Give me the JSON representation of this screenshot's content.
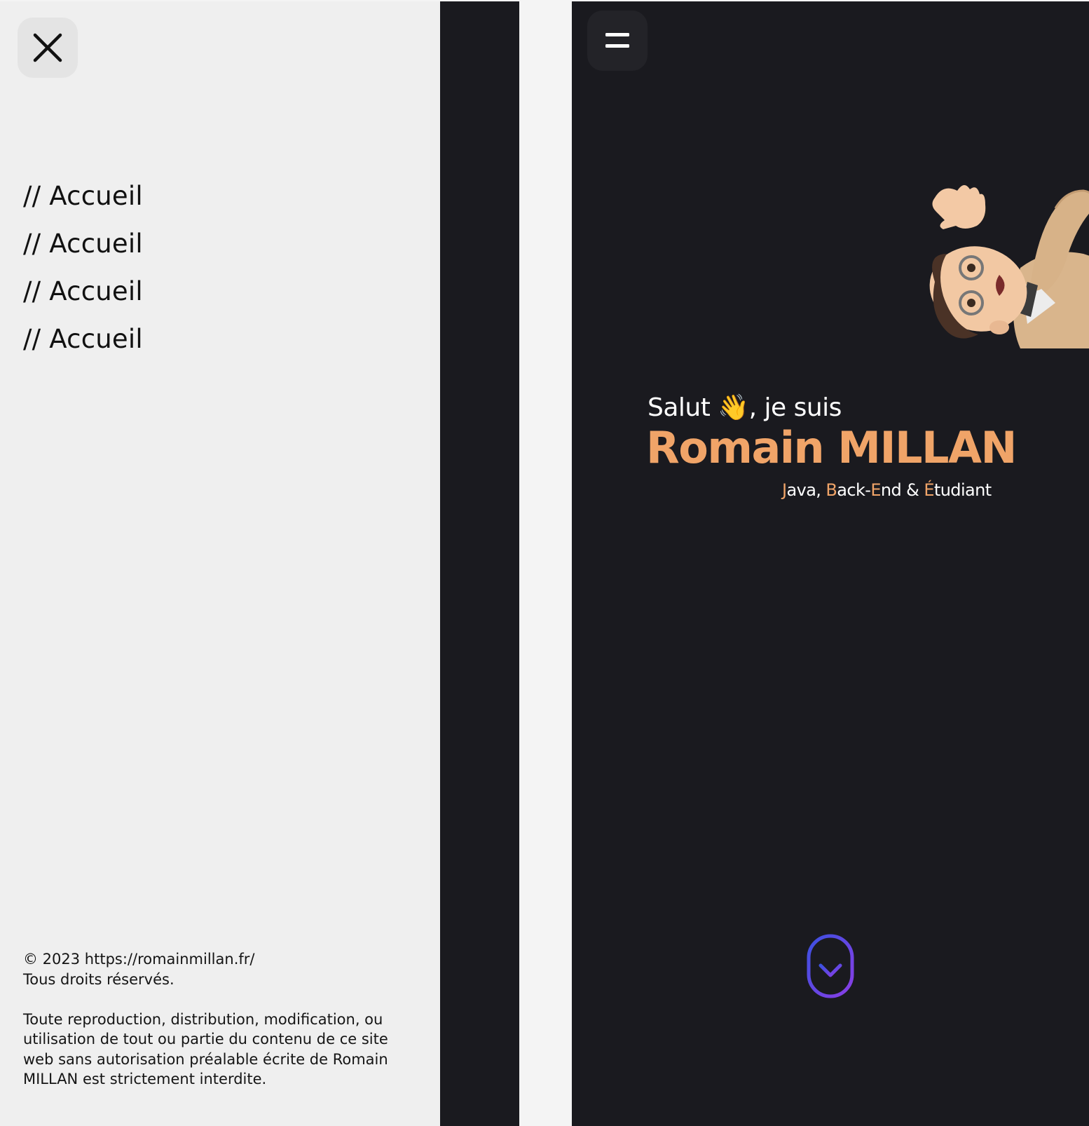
{
  "drawer": {
    "close_icon": "close-icon",
    "nav_items": [
      {
        "label": "// Accueil"
      },
      {
        "label": "// Accueil"
      },
      {
        "label": "// Accueil"
      },
      {
        "label": "// Accueil"
      }
    ],
    "copyright_line1": "© 2023 https://romainmillan.fr/",
    "copyright_line2": "Tous droits réservés.",
    "legal_notice": "Toute reproduction, distribution, modification, ou utilisation de tout ou partie du contenu de ce site web sans autorisation préalable écrite de Romain MILLAN est strictement interdite."
  },
  "hero": {
    "menu_icon": "hamburger-menu-icon",
    "greeting_before": "Salut ",
    "greeting_emoji": "👋",
    "greeting_after": ", je suis",
    "name": "Romain MILLAN",
    "tagline": {
      "j": "J",
      "java_rest": "ava, ",
      "b": "B",
      "back_rest": "ack-",
      "e": "E",
      "end_rest": "nd & ",
      "e2": "É",
      "etudiant_rest": "tudiant"
    },
    "scroll_icon": "scroll-down-icon",
    "avatar_icon": "waving-avatar"
  },
  "colors": {
    "accent": "#f0a468",
    "dark_bg": "#1a1a1f",
    "drawer_bg": "#efefef",
    "scroll_gradient_start": "#3b50e0",
    "scroll_gradient_end": "#8a3ee6"
  }
}
